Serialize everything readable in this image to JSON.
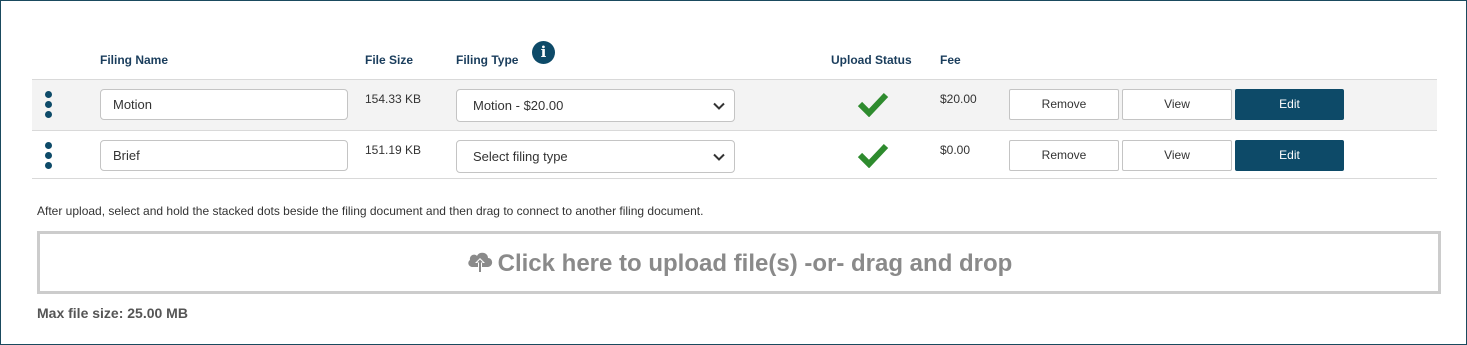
{
  "headers": {
    "filing_name": "Filing Name",
    "file_size": "File Size",
    "filing_type": "Filing Type",
    "upload_status": "Upload Status",
    "fee": "Fee"
  },
  "rows": [
    {
      "filing_name": "Motion",
      "file_size": "154.33 KB",
      "filing_type": "Motion - $20.00",
      "upload_status": "complete",
      "fee": "$20.00",
      "remove_label": "Remove",
      "view_label": "View",
      "edit_label": "Edit"
    },
    {
      "filing_name": "Brief",
      "file_size": "151.19 KB",
      "filing_type": "Select filing type",
      "upload_status": "complete",
      "fee": "$0.00",
      "remove_label": "Remove",
      "view_label": "View",
      "edit_label": "Edit"
    }
  ],
  "hint_text": "After upload, select and hold the stacked dots beside the filing document and then drag to connect to another filing document.",
  "upload": {
    "label": "Click here to upload file(s) -or- drag and drop",
    "icon": "cloud-upload-icon"
  },
  "max_file_size": "Max file size: 25.00 MB",
  "icons": {
    "info": "info-icon",
    "drag": "drag-handle-icon",
    "status": "checkmark-icon",
    "dropdown": "chevron-down-icon"
  },
  "colors": {
    "primary": "#0d4a68",
    "success": "#2e8b2e",
    "header_text": "#1a3d5c",
    "muted": "#8a8a8a"
  }
}
